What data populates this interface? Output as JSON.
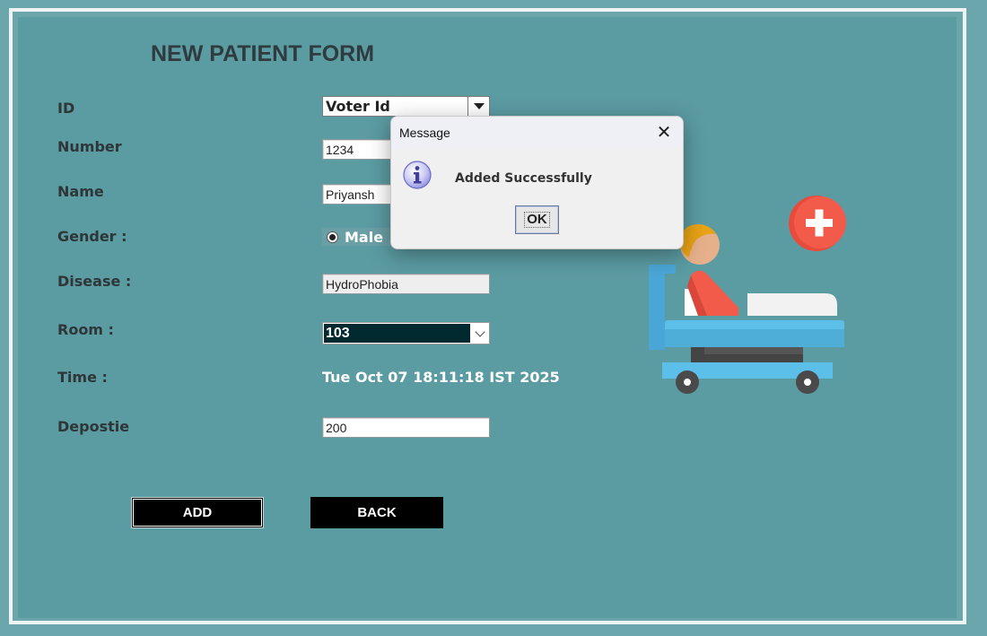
{
  "form": {
    "title": "NEW PATIENT FORM",
    "labels": {
      "id": "ID",
      "number": "Number",
      "name": "Name",
      "gender": "Gender :",
      "disease": "Disease :",
      "room": "Room :",
      "time": "Time :",
      "deposit": "Depostie"
    },
    "id_type": "Voter Id",
    "number": "1234",
    "name": "Priyansh",
    "gender_selected": "Male",
    "disease": "HydroPhobia",
    "room": "103",
    "time": "Tue Oct 07 18:11:18 IST 2025",
    "deposit": "200",
    "buttons": {
      "add": "ADD",
      "back": "BACK"
    }
  },
  "dialog": {
    "title": "Message",
    "message": "Added Successfully",
    "ok": "OK",
    "icon": "info-icon",
    "close_icon": "close-icon"
  },
  "colors": {
    "background": "#5b9ba2",
    "button": "#000000",
    "room_selected": "#002a30",
    "plus_badge": "#e84b3c",
    "bed": "#5bbfe9"
  }
}
